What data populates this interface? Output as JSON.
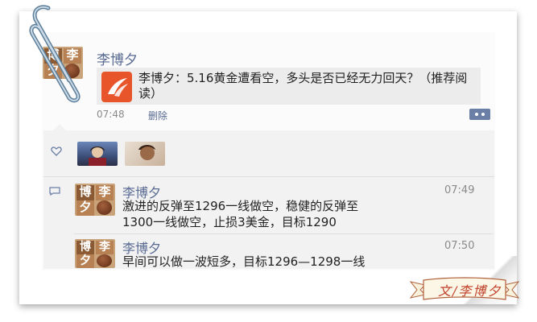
{
  "post": {
    "author": "李博夕",
    "avatar_text": [
      "博",
      "李",
      "夕"
    ],
    "share_text": "李博夕：5.16黄金遭看空，多头是否已经无力回天？（推荐阅读）",
    "time": "07:48",
    "delete_label": "删除"
  },
  "comments": [
    {
      "author": "李博夕",
      "time": "07:49",
      "text_lines": [
        "激进的反弹至1296一线做空，稳健的反弹至",
        "1300一线做空，止损3美金，目标1290"
      ]
    },
    {
      "author": "李博夕",
      "time": "07:50",
      "text_lines": [
        "早间可以做一波短多，目标1296—1298一线"
      ]
    }
  ],
  "banner": {
    "text": "文/李博夕"
  },
  "colors": {
    "name": "#586a92",
    "share_icon": "#e8552a",
    "banner_text": "#c0402a"
  },
  "icons": [
    "paperclip-icon",
    "like-heart-icon",
    "comment-bubble-icon",
    "more-actions-icon",
    "share-app-icon"
  ]
}
